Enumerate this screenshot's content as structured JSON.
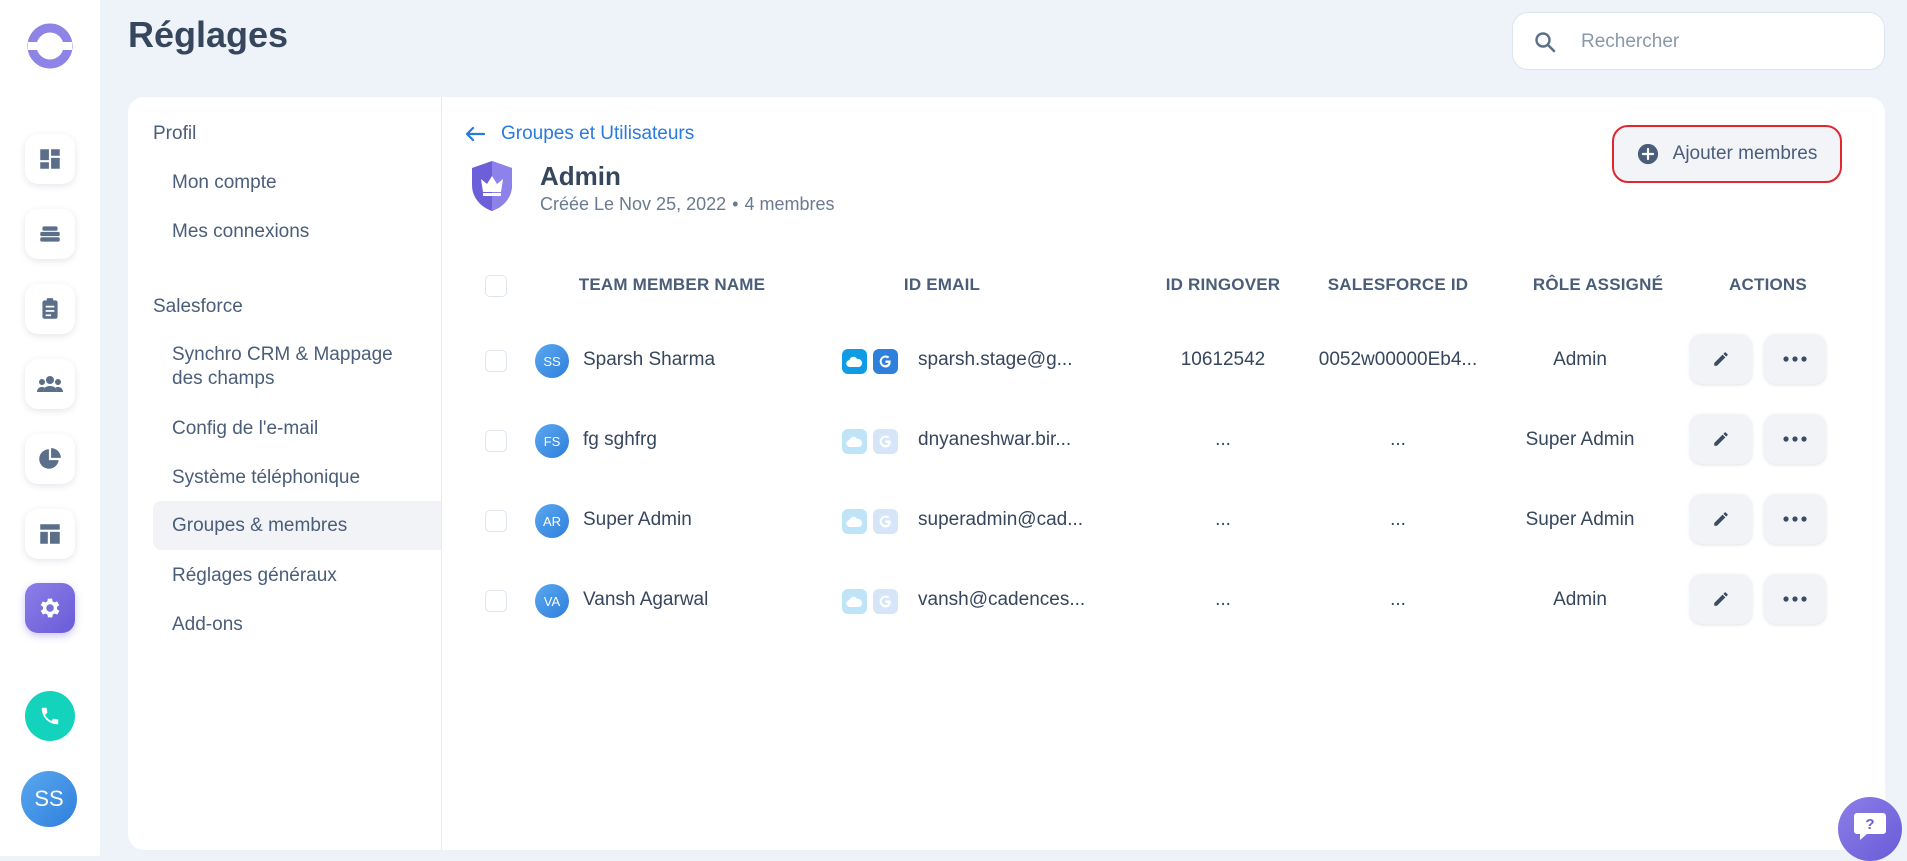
{
  "header": {
    "title": "Réglages",
    "search_placeholder": "Rechercher"
  },
  "rail": {
    "items": [
      {
        "icon": "dashboard-icon"
      },
      {
        "icon": "stack-icon"
      },
      {
        "icon": "clipboard-icon"
      },
      {
        "icon": "people-icon"
      },
      {
        "icon": "pie-chart-icon"
      },
      {
        "icon": "layout-icon"
      },
      {
        "icon": "gear-icon",
        "active": true
      }
    ],
    "call_icon": "phone-icon",
    "user_initials": "SS"
  },
  "settings_nav": {
    "sections": [
      {
        "label": "Profil",
        "items": [
          "Mon compte",
          "Mes connexions"
        ]
      },
      {
        "label": "Salesforce",
        "items": [
          "Synchro CRM & Mappage des champs",
          "Config de l'e-mail",
          "Système téléphonique",
          "Groupes & membres",
          "Réglages généraux",
          "Add-ons"
        ]
      }
    ],
    "active_item": "Groupes & membres"
  },
  "group": {
    "back_label": "Groupes et Utilisateurs",
    "name": "Admin",
    "created": "Créée Le Nov 25, 2022",
    "separator": "•",
    "members_count": "4 membres",
    "add_button": "Ajouter membres"
  },
  "table": {
    "headers": {
      "name": "TEAM MEMBER NAME",
      "email": "ID EMAIL",
      "ringover": "ID RINGOVER",
      "salesforce": "SALESFORCE ID",
      "role": "RÔLE ASSIGNÉ",
      "actions": "ACTIONS"
    },
    "rows": [
      {
        "initials": "SS",
        "name": "Sparsh Sharma",
        "email": "sparsh.stage@g...",
        "ringover": "10612542",
        "salesforce": "0052w00000Eb4...",
        "role": "Admin",
        "connected": true
      },
      {
        "initials": "FS",
        "name": "fg sghfrg",
        "email": "dnyaneshwar.bir...",
        "ringover": "...",
        "salesforce": "...",
        "role": "Super Admin",
        "connected": false
      },
      {
        "initials": "AR",
        "name": "Super Admin",
        "email": "superadmin@cad...",
        "ringover": "...",
        "salesforce": "...",
        "role": "Super Admin",
        "connected": false
      },
      {
        "initials": "VA",
        "name": "Vansh Agarwal",
        "email": "vansh@cadences...",
        "ringover": "...",
        "salesforce": "...",
        "role": "Admin",
        "connected": false
      }
    ]
  },
  "colors": {
    "accent": "#2a79df",
    "brand_purple": "#7b6cde",
    "highlight_border": "#e0262f",
    "call_green": "#14d3bd",
    "salesforce_blue": "#109ce4"
  }
}
